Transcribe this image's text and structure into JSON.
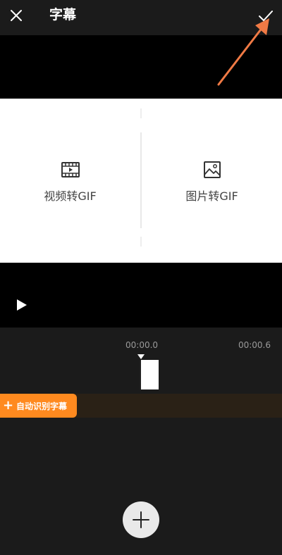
{
  "header": {
    "title": "字幕",
    "close_icon": "close-icon",
    "confirm_icon": "check-icon"
  },
  "options": [
    {
      "label": "视频转GIF",
      "icon": "film-icon"
    },
    {
      "label": "图片转GIF",
      "icon": "image-icon"
    }
  ],
  "player": {
    "play_icon": "play-icon"
  },
  "timeline": {
    "start_time": "00:00.0",
    "end_time": "00:00.6"
  },
  "subtitle_track": {
    "auto_button_label": "自动识别字幕"
  },
  "add_button": {
    "icon": "plus-icon"
  },
  "colors": {
    "accent": "#ff8a1f",
    "annotation_arrow": "#f07a45",
    "background": "#1b1b1b"
  }
}
